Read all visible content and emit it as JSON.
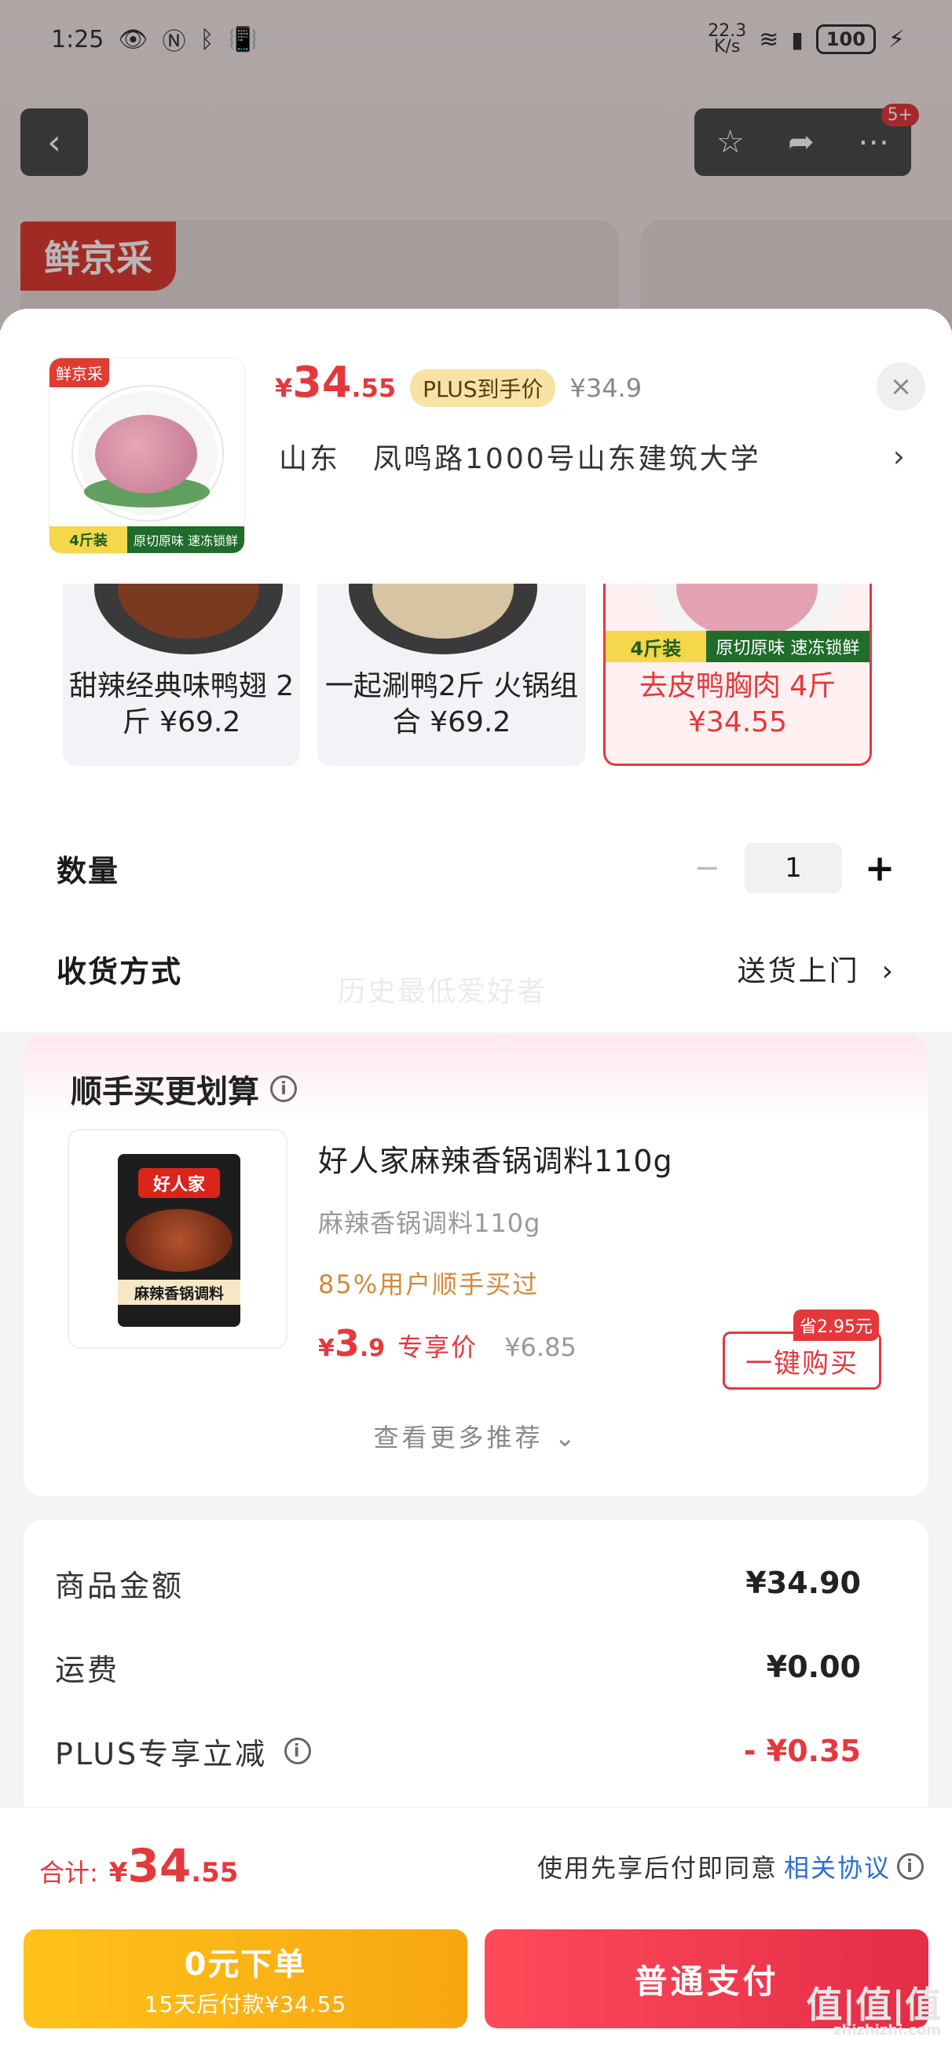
{
  "status_bar": {
    "time": "1:25",
    "net_speed": "22.3\nK/s",
    "battery": "100"
  },
  "background_page": {
    "logo": "鲜京采",
    "cart_badge": "5+"
  },
  "sheet": {
    "thumbnail": {
      "tag": "鲜京采",
      "band_left": "4斤装",
      "band_right": "原切原味 速冻锁鲜"
    },
    "price": {
      "symbol": "¥",
      "integer": "34",
      "decimal": ".55"
    },
    "plus_tag": "PLUS到手价",
    "original_price": "¥34.9",
    "close_icon": "×",
    "address": {
      "province": "山东",
      "detail": "凤鸣路1000号山东建筑大学"
    }
  },
  "variants": [
    {
      "label": "甜辣经典味鸭翅 2斤 ¥69.2"
    },
    {
      "label": "一起涮鸭2斤 火锅组合 ¥69.2"
    },
    {
      "label": "去皮鸭胸肉 4斤 ¥34.55",
      "band_left": "4斤装",
      "band_right": "原切原味 速冻锁鲜"
    }
  ],
  "quantity": {
    "label": "数量",
    "value": "1",
    "minus": "−",
    "plus": "+"
  },
  "shipping": {
    "label": "收货方式",
    "value": "送货上门"
  },
  "watermark": "历史最低爱好者",
  "recommend": {
    "title": "顺手买更划算",
    "product_pack_brand": "好人家",
    "product_pack_name": "麻辣香锅调料",
    "name": "好人家麻辣香锅调料110g",
    "sub": "麻辣香锅调料110g",
    "users": "85%用户顺手买过",
    "price": {
      "symbol": "¥",
      "integer": "3",
      "decimal": ".9"
    },
    "exclusive": "专享价",
    "original_price": "¥6.85",
    "save_tag": "省2.95元",
    "buy_label": "一键购买",
    "more": "查看更多推荐"
  },
  "summary": {
    "goods_label": "商品金额",
    "goods_value": "¥34.90",
    "freight_label": "运费",
    "freight_value": "¥0.00",
    "plus_label": "PLUS专享立减",
    "plus_value": "- ¥0.35"
  },
  "footer": {
    "total_label": "合计:",
    "total": {
      "symbol": "¥",
      "integer": "34",
      "decimal": ".55"
    },
    "agree_text": "使用先享后付即同意",
    "agree_link": "相关协议",
    "pay_zero_line1": "0元下单",
    "pay_zero_line2": "15天后付款¥34.55",
    "pay_normal": "普通支付",
    "site_mark": "值|值|值",
    "site_url": "zhizhizhi.com"
  },
  "colors": {
    "accent_red": "#e4393c",
    "plus_gold": "#f7e3a4",
    "pay_zero_yellow": "#ffc21a",
    "link_blue": "#2a6fd6"
  }
}
